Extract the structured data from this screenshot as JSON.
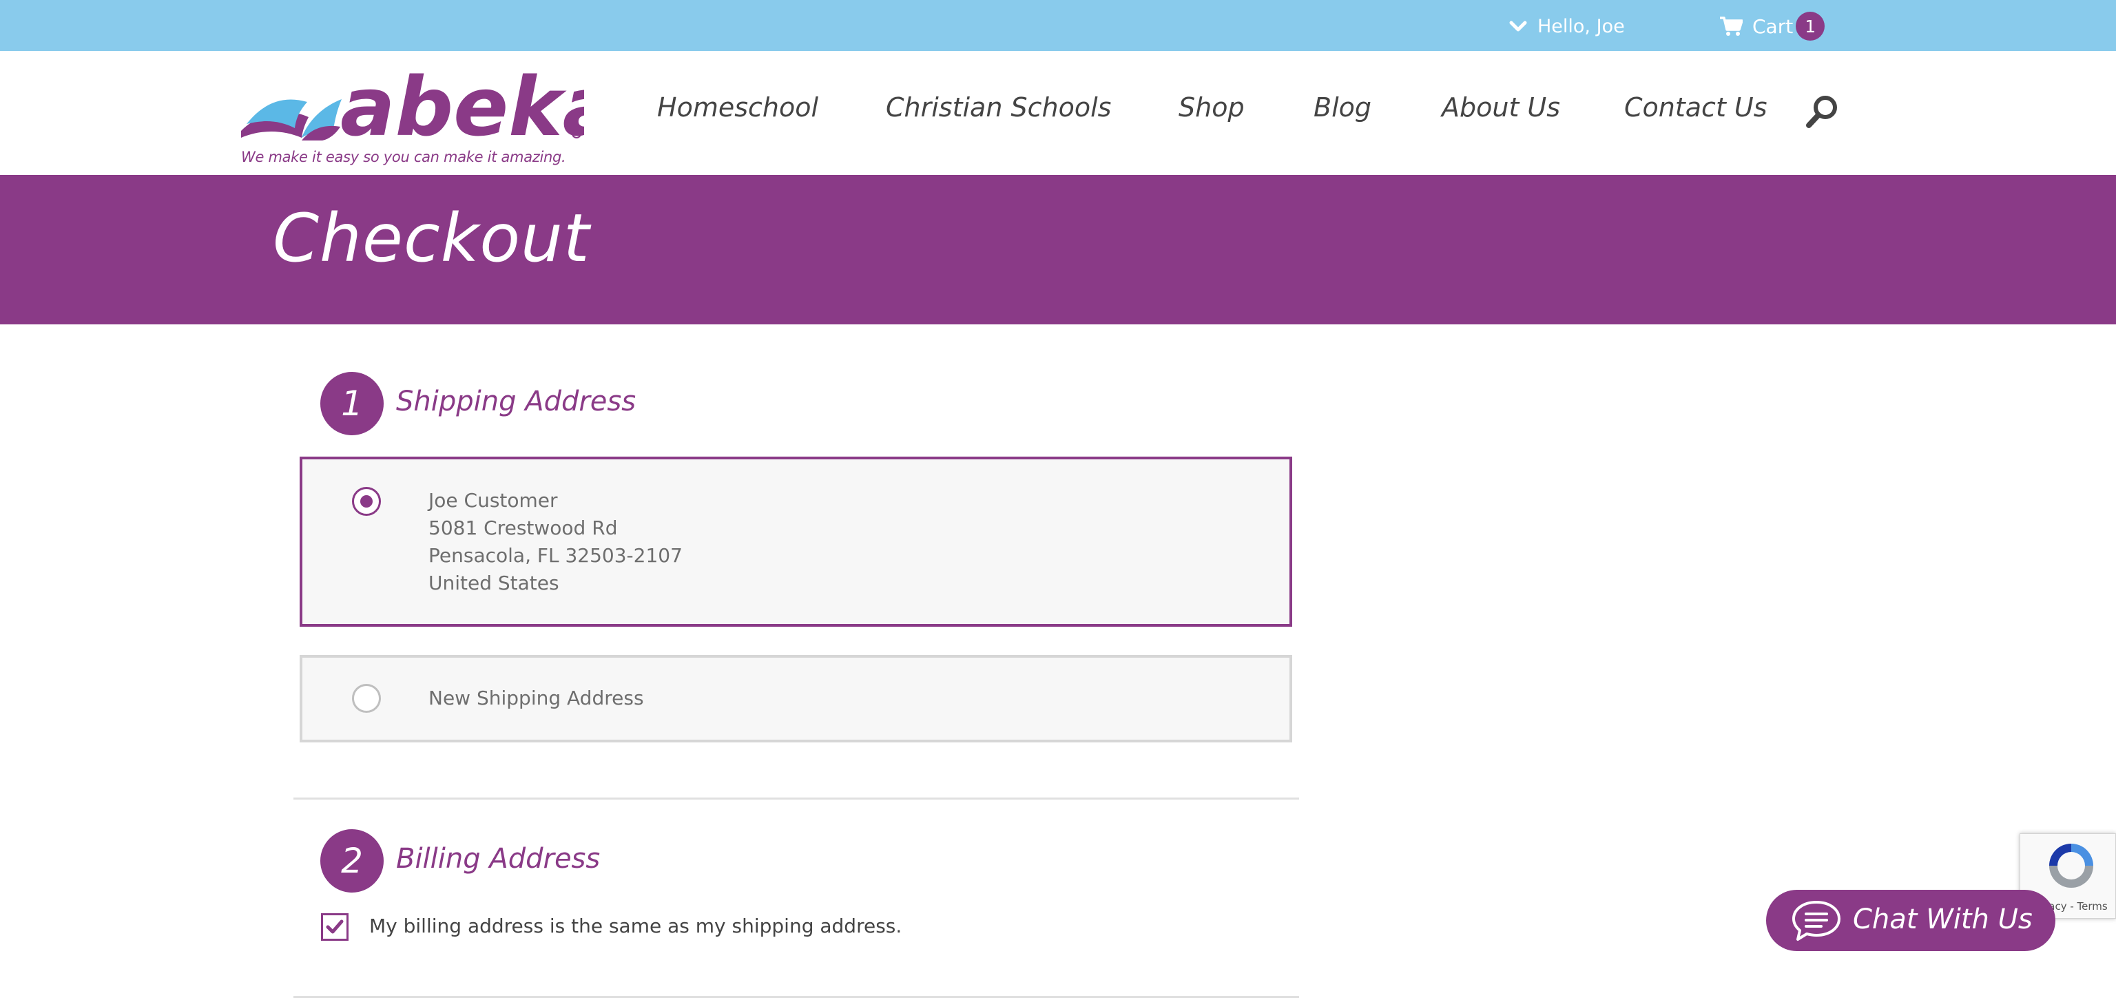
{
  "topbar": {
    "greeting": "Hello, Joe",
    "cart_label": "Cart",
    "cart_count": "1",
    "icons": [
      "chevron-down-icon",
      "shopping-cart-icon"
    ]
  },
  "header": {
    "logo_text": "abeka",
    "tagline": "We make it easy so you can make it amazing.",
    "nav": [
      "Homeschool",
      "Christian Schools",
      "Shop",
      "Blog",
      "About Us",
      "Contact Us"
    ],
    "search_icon": "search-icon"
  },
  "banner": {
    "title": "Checkout"
  },
  "shipping": {
    "step": "1",
    "title": "Shipping Address",
    "selected_address": [
      "Joe Customer",
      "5081 Crestwood Rd",
      "Pensacola, FL 32503-2107",
      "United States"
    ],
    "new_address_label": "New Shipping Address"
  },
  "billing": {
    "step": "2",
    "title": "Billing Address",
    "same_as_shipping_label": "My billing address is the same as my shipping address.",
    "same_as_shipping_checked": true
  },
  "chat": {
    "label": "Chat With Us"
  },
  "recaptcha": {
    "text": "Privacy - Terms"
  },
  "colors": {
    "topbar": "#89cbec",
    "brand_purple": "#8a3a87",
    "logo_blue": "#5bb8e6",
    "card_bg": "#f7f7f7"
  }
}
